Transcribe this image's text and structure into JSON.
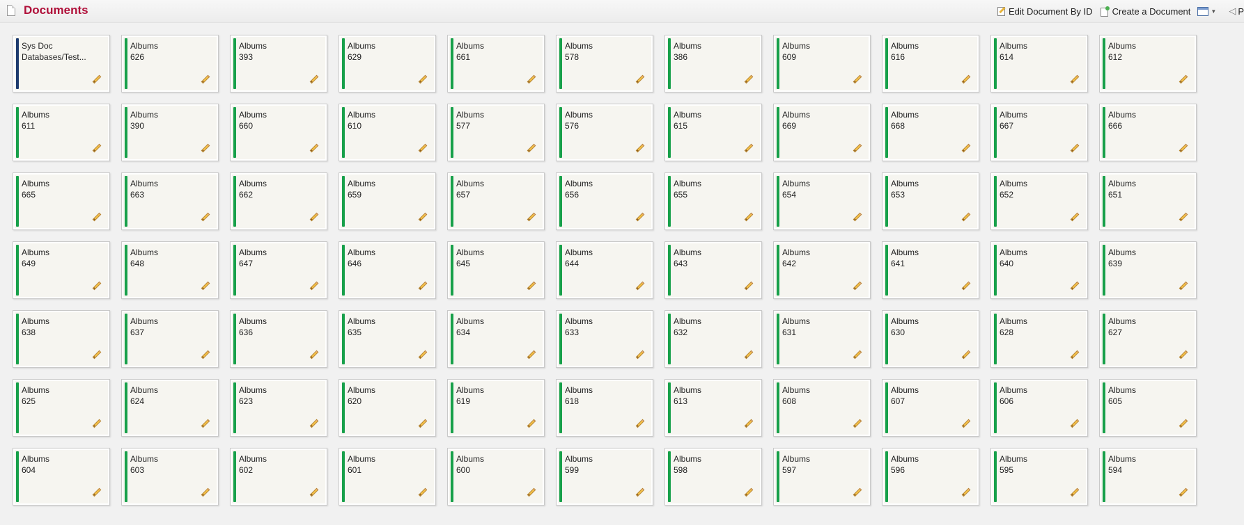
{
  "header": {
    "title": "Documents",
    "edit_by_id": "Edit Document By ID",
    "create": "Create a Document",
    "back_fragment": "P"
  },
  "first_card": {
    "line1": "Sys Doc",
    "line2": "Databases/Test..."
  },
  "album_label": "Albums",
  "album_ids": [
    "626",
    "393",
    "629",
    "661",
    "578",
    "386",
    "609",
    "616",
    "614",
    "612",
    "611",
    "390",
    "660",
    "610",
    "577",
    "576",
    "615",
    "669",
    "668",
    "667",
    "666",
    "665",
    "663",
    "662",
    "659",
    "657",
    "656",
    "655",
    "654",
    "653",
    "652",
    "651",
    "649",
    "648",
    "647",
    "646",
    "645",
    "644",
    "643",
    "642",
    "641",
    "640",
    "639",
    "638",
    "637",
    "636",
    "635",
    "634",
    "633",
    "632",
    "631",
    "630",
    "628",
    "627",
    "625",
    "624",
    "623",
    "620",
    "619",
    "618",
    "613",
    "608",
    "607",
    "606",
    "605",
    "604",
    "603",
    "602",
    "601",
    "600",
    "599",
    "598",
    "597",
    "596",
    "595",
    "594"
  ],
  "colors": {
    "title": "#b0103a",
    "bar_green": "#17a04a",
    "bar_navy": "#1d3b6e"
  }
}
